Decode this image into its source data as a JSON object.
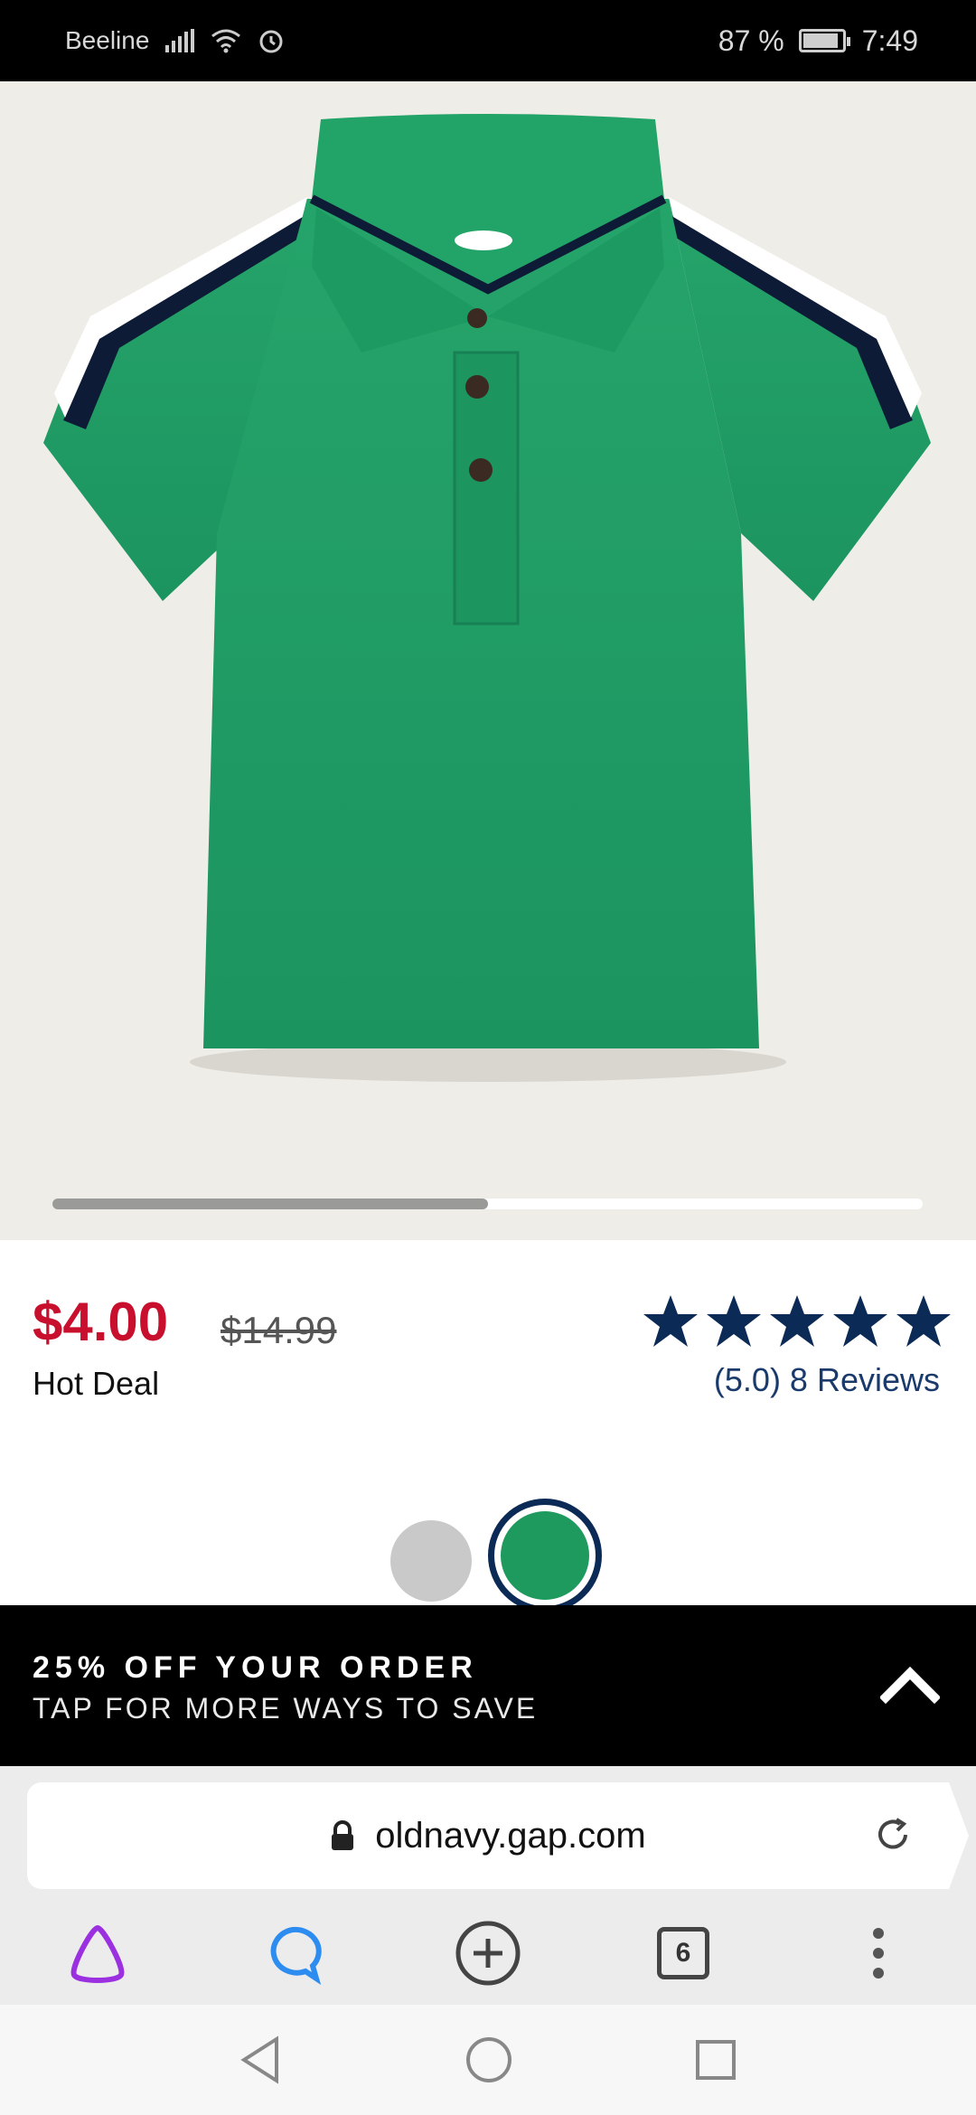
{
  "status_bar": {
    "carrier": "Beeline",
    "battery": "87 %",
    "time": "7:49"
  },
  "product": {
    "image_alt": "Green polo shirt",
    "carousel_progress": 0.5
  },
  "pricing": {
    "current_price": "$4.00",
    "original_price": "$14.99",
    "deal_label": "Hot Deal",
    "rating_stars": 5,
    "reviews": "(5.0) 8 Reviews"
  },
  "swatches": [
    {
      "name": "gray",
      "color": "#c9c9c9"
    },
    {
      "name": "green",
      "color": "#1f9a5f",
      "selected": true
    }
  ],
  "promo": {
    "title": "25% OFF YOUR ORDER",
    "subtitle": "TAP FOR MORE WAYS TO SAVE"
  },
  "browser": {
    "url": "oldnavy.gap.com",
    "tab_count": "6"
  },
  "colors": {
    "price_red": "#c8102e",
    "star_navy": "#0b2a55",
    "shirt_green": "#1f9a5f"
  }
}
